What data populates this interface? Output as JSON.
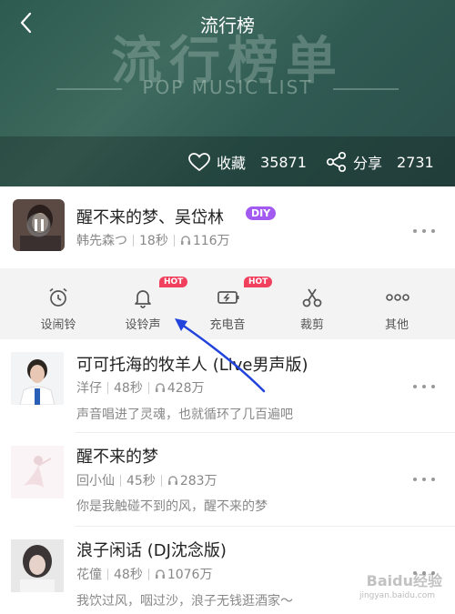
{
  "header": {
    "title": "流行榜",
    "big_title": "流行榜单",
    "subtitle": "POP MUSIC LIST",
    "collect_label": "收藏",
    "collect_count": "35871",
    "share_label": "分享",
    "share_count": "2731",
    "icons": [
      "chevron-left-icon",
      "heart-icon",
      "share-icon"
    ]
  },
  "now_playing": {
    "title": "醒不来的梦、吴岱林",
    "badge": "DIY",
    "artist": "韩先森つ",
    "duration": "18秒",
    "plays": "116万",
    "badge_color": "#a25af0"
  },
  "actions": [
    {
      "label": "设闹铃",
      "icon": "alarm-clock-icon",
      "hot": ""
    },
    {
      "label": "设铃声",
      "icon": "bell-icon",
      "hot": "HOT"
    },
    {
      "label": "充电音",
      "icon": "battery-charging-icon",
      "hot": "HOT"
    },
    {
      "label": "裁剪",
      "icon": "scissors-icon",
      "hot": ""
    },
    {
      "label": "其他",
      "icon": "more-icon",
      "hot": ""
    }
  ],
  "songs": [
    {
      "title": "可可托海的牧羊人 (Live男声版)",
      "artist": "洋仔",
      "duration": "48秒",
      "plays": "428万",
      "comment": "声音唱进了灵魂，也就循环了几百遍吧"
    },
    {
      "title": "醒不来的梦",
      "artist": "回小仙",
      "duration": "45秒",
      "plays": "283万",
      "comment": "你是我触碰不到的风，醒不来的梦"
    },
    {
      "title": "浪子闲话 (DJ沈念版)",
      "artist": "花僮",
      "duration": "48秒",
      "plays": "1076万",
      "comment": "我饮过风，咽过沙，浪子无钱逛酒家～"
    }
  ],
  "watermark": {
    "text": "Baidu经验",
    "url": "jingyan.baidu.com"
  },
  "colors": {
    "hot": "#f13f5e",
    "accent": "#a25af0",
    "arrow": "#2244dd"
  }
}
